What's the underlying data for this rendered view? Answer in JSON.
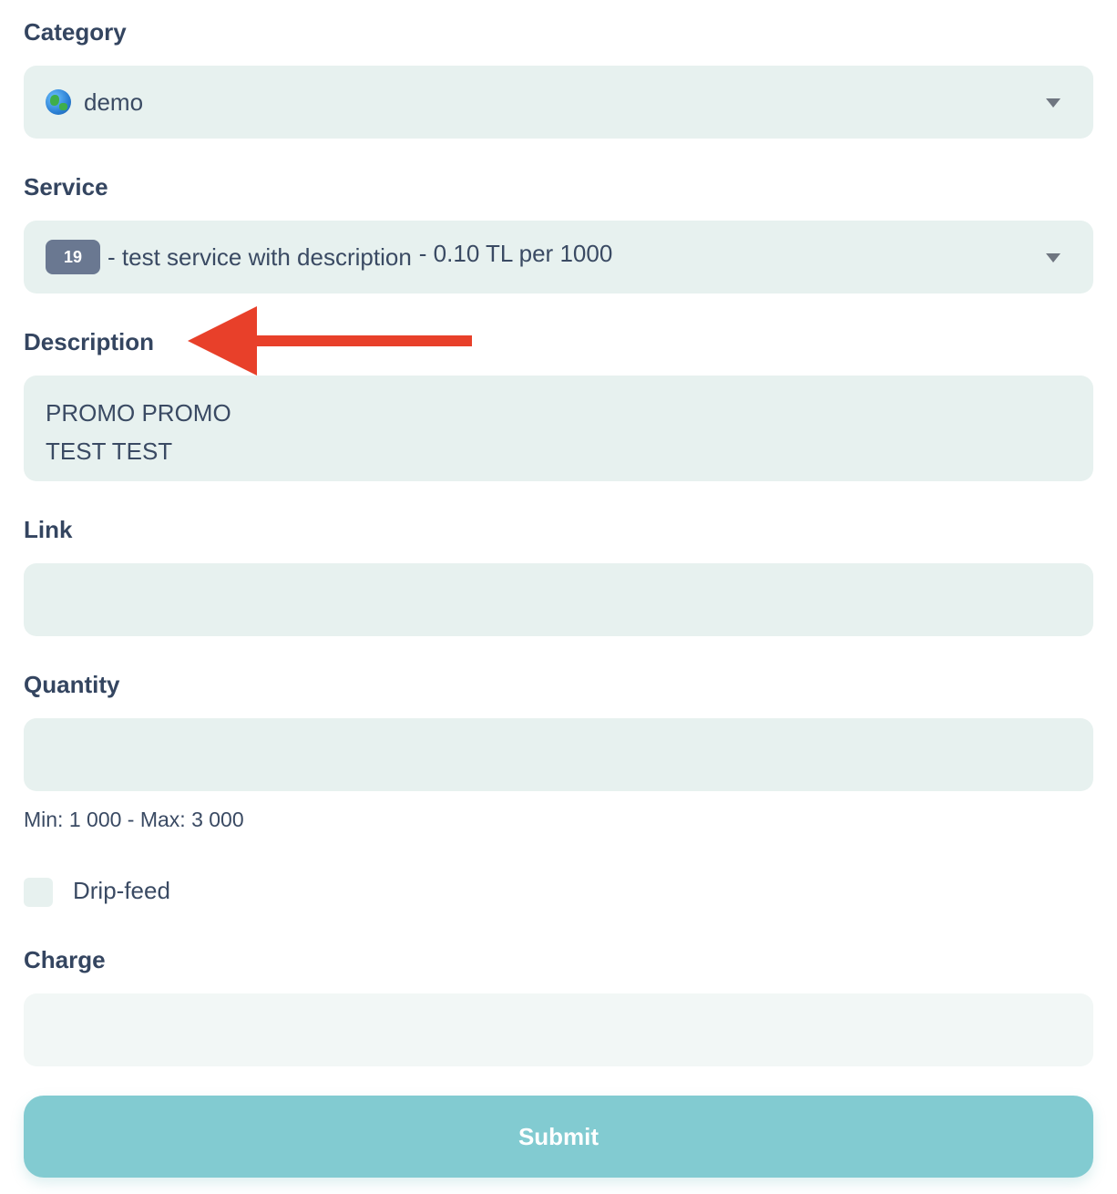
{
  "category": {
    "label": "Category",
    "selected": "demo",
    "icon": "globe-icon"
  },
  "service": {
    "label": "Service",
    "id_badge": "19",
    "name": "- test service with description",
    "price": "- 0.10 TL per 1000"
  },
  "description": {
    "label": "Description",
    "lines": [
      "PROMO PROMO",
      "TEST TEST"
    ]
  },
  "link": {
    "label": "Link",
    "value": ""
  },
  "quantity": {
    "label": "Quantity",
    "value": "",
    "help": "Min: 1 000 - Max: 3 000"
  },
  "drip_feed": {
    "label": "Drip-feed",
    "checked": false
  },
  "charge": {
    "label": "Charge",
    "value": ""
  },
  "submit": {
    "label": "Submit"
  },
  "colors": {
    "field_bg": "#e7f1ef",
    "label_text": "#344560",
    "submit_bg": "#82cbd1",
    "arrow": "#e8402a"
  }
}
